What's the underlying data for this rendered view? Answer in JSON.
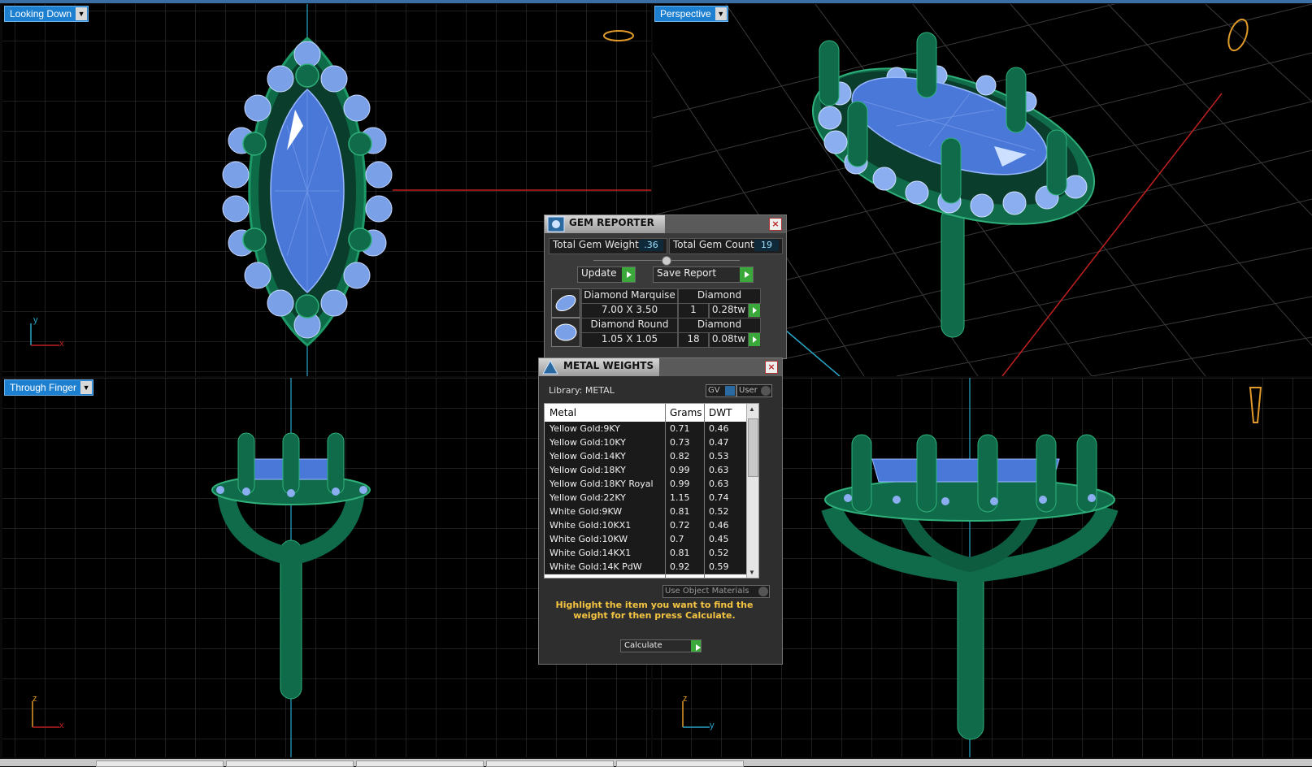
{
  "viewports": {
    "top_left": {
      "label": "Looking Down",
      "axis_a": "y",
      "axis_b": "x"
    },
    "top_right": {
      "label": "Perspective"
    },
    "bottom_left": {
      "label": "Through Finger",
      "axis_a": "z",
      "axis_b": "x"
    },
    "bottom_right": {
      "axis_a": "z",
      "axis_b": "y"
    }
  },
  "gem_reporter": {
    "title": "GEM REPORTER",
    "close": "×",
    "total_weight_label": "Total Gem Weight",
    "total_weight_value": ".36",
    "total_count_label": "Total Gem Count",
    "total_count_value": "19",
    "update_label": "Update",
    "save_report_label": "Save Report",
    "gems": [
      {
        "name": "Diamond Marquise",
        "type": "Diamond",
        "size": "7.00 X 3.50",
        "qty": "1",
        "weight": "0.28tw"
      },
      {
        "name": "Diamond Round",
        "type": "Diamond",
        "size": "1.05 X 1.05",
        "qty": "18",
        "weight": "0.08tw"
      }
    ]
  },
  "metal_weights": {
    "title": "METAL WEIGHTS",
    "close": "×",
    "library_label": "Library: METAL",
    "gv_label": "GV",
    "user_label": "User",
    "columns": [
      "Metal",
      "Grams",
      "DWT"
    ],
    "rows": [
      [
        "Yellow Gold:9KY",
        "0.71",
        "0.46"
      ],
      [
        "Yellow Gold:10KY",
        "0.73",
        "0.47"
      ],
      [
        "Yellow Gold:14KY",
        "0.82",
        "0.53"
      ],
      [
        "Yellow Gold:18KY",
        "0.99",
        "0.63"
      ],
      [
        "Yellow Gold:18KY Royal",
        "0.99",
        "0.63"
      ],
      [
        "Yellow Gold:22KY",
        "1.15",
        "0.74"
      ],
      [
        "White Gold:9KW",
        "0.81",
        "0.52"
      ],
      [
        "White Gold:10KX1",
        "0.72",
        "0.46"
      ],
      [
        "White Gold:10KW",
        "0.7",
        "0.45"
      ],
      [
        "White Gold:14KX1",
        "0.81",
        "0.52"
      ],
      [
        "White Gold:14K PdW",
        "0.92",
        "0.59"
      ]
    ],
    "use_object_materials": "Use Object Materials",
    "hint": "Highlight the item you want to find the weight for then press Calculate.",
    "calculate_label": "Calculate"
  },
  "colors": {
    "metal": "#0f6b4a",
    "gem": "#4a78d8",
    "grid": "#3a3a3a",
    "label_bg": "#1d7fd0",
    "hint": "#f5c542"
  }
}
